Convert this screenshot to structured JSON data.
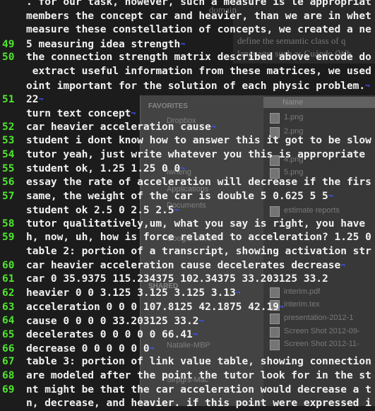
{
  "background": {
    "doc_text": [
      "domain",
      "define the semantic class of q",
      "language, such as Cuándo (Wh"
    ],
    "finder_sidebar": [
      "FAVORITES",
      "Dropbox",
      "lwheng",
      "Applications",
      "Documents",
      "Google Drive",
      "SHARED",
      "Natalie-MBP",
      "Sirpgrs-Mac"
    ],
    "finder_column_header": "Name",
    "finder_files": [
      "1.png",
      "2.png",
      "4.png",
      "5.png",
      "estimate reports",
      "interim.pdf",
      "interim.tex",
      "presentation-2012-1",
      "Screen Shot 2012-09-",
      "Screen Shot 2012-11-"
    ]
  },
  "terminal": {
    "colors": {
      "background": "#1c1c1c",
      "text": "#f2f2f2",
      "line_number": "#4ee62e",
      "eol_marker": "#3f56ff"
    },
    "eol_marker": "¬",
    "lines": [
      {
        "num": "",
        "text": ". for our task, however, such a measure is le appropriat",
        "eol": false
      },
      {
        "num": "",
        "text": "members the concept car and heavier, than we are in whet",
        "eol": false
      },
      {
        "num": "",
        "text": "measure these constellation of concepts, we created a ne",
        "eol": false
      },
      {
        "num": "49",
        "text": "5 measuring idea strength",
        "eol": true
      },
      {
        "num": "50",
        "text": "the connection strength matrix described above encode do",
        "eol": false
      },
      {
        "num": "",
        "text": " extract useful information from these matrices, we used",
        "eol": false
      },
      {
        "num": "",
        "text": "oint important for the solution of each physic problem.",
        "eol": true
      },
      {
        "num": "51",
        "text": "22",
        "eol": true
      },
      {
        "num": "",
        "text": "turn text concept",
        "eol": true
      },
      {
        "num": "52",
        "text": "car heavier acceleration cause",
        "eol": true
      },
      {
        "num": "53",
        "text": "student i dont know how to answer this it got to be slow",
        "eol": false
      },
      {
        "num": "54",
        "text": "tutor yeah, just write whatever you this is appropriate",
        "eol": false
      },
      {
        "num": "55",
        "text": "student ok, 1.25 1.25 0 0",
        "eol": true
      },
      {
        "num": "56",
        "text": "essay the rate of acceleration will decrease if the firs",
        "eol": false
      },
      {
        "num": "57",
        "text": "same, the weight of the car is double 5 0.625 5 5",
        "eol": true
      },
      {
        "num": "",
        "text": "student ok 2.5 0 2.5 2.5",
        "eol": true
      },
      {
        "num": "58",
        "text": "tutor qualitatively,um, what you say is right, you have",
        "eol": false
      },
      {
        "num": "59",
        "text": "h, now, uh, how is force related to acceleration? 1.25 0",
        "eol": false
      },
      {
        "num": "",
        "text": "table 2: portion of a transcript, showing activation str",
        "eol": false
      },
      {
        "num": "60",
        "text": "car heavier acceleration cause decelerates decrease",
        "eol": true
      },
      {
        "num": "61",
        "text": "car 0 35.9375 115.234375 102.34375 33.203125 33.2",
        "eol": false
      },
      {
        "num": "62",
        "text": "heavier 0 0 3.125 3.125 3.125 3.13",
        "eol": true
      },
      {
        "num": "63",
        "text": "acceleration 0 0 0 107.8125 42.1875 42.19",
        "eol": true
      },
      {
        "num": "64",
        "text": "cause 0 0 0 0 33.203125 33.2",
        "eol": true
      },
      {
        "num": "65",
        "text": "decelerates 0 0 0 0 0 66.41",
        "eol": true
      },
      {
        "num": "66",
        "text": "decrease 0 0 0 0 0 0",
        "eol": true
      },
      {
        "num": "67",
        "text": "table 3: portion of link value table, showing connection",
        "eol": false
      },
      {
        "num": "68",
        "text": "are modeled after the point the tutor look for in the st",
        "eol": false
      },
      {
        "num": "69",
        "text": "nt might be that the car acceleration would decrease a t",
        "eol": false
      },
      {
        "num": "",
        "text": "n, decrease, and heavier. if this point were expressed i",
        "eol": false
      }
    ]
  }
}
